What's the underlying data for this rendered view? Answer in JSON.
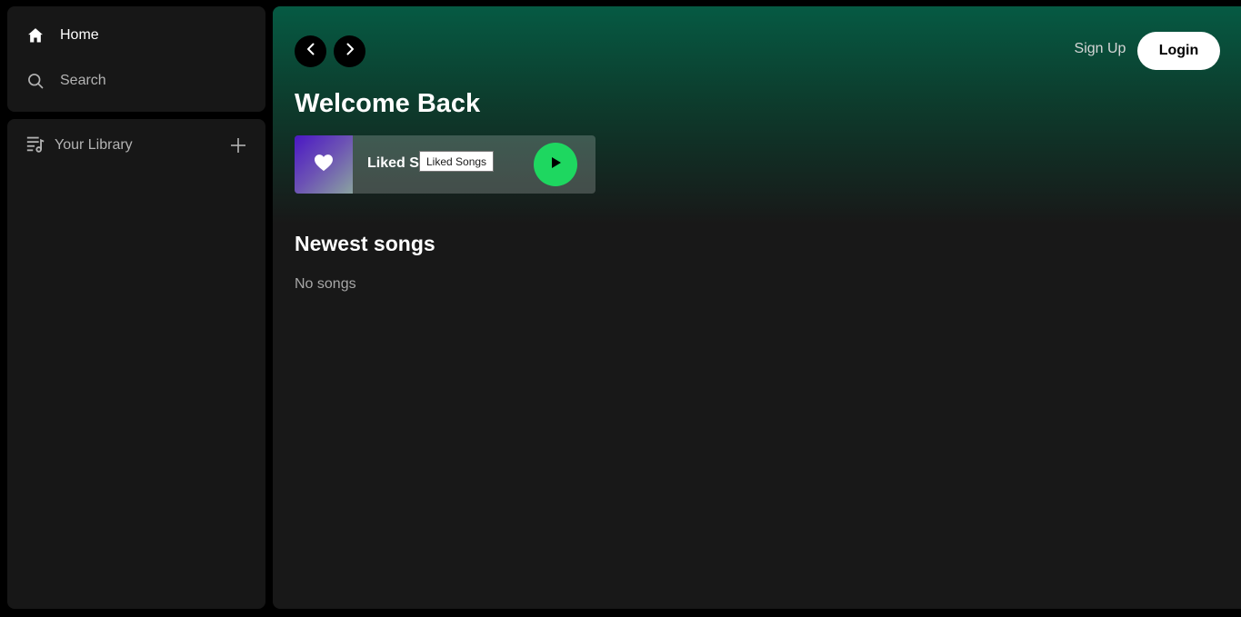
{
  "sidebar": {
    "nav": [
      {
        "label": "Home",
        "icon": "home-icon",
        "active": true
      },
      {
        "label": "Search",
        "icon": "search-icon",
        "active": false
      }
    ],
    "library": {
      "label": "Your Library",
      "icon": "library-icon",
      "add_icon": "plus-icon"
    }
  },
  "header": {
    "back_icon": "chevron-left-icon",
    "forward_icon": "chevron-right-icon",
    "signup_label": "Sign Up",
    "login_label": "Login"
  },
  "main": {
    "welcome_title": "Welcome Back",
    "liked_card": {
      "title": "Liked Songs",
      "icon": "heart-icon",
      "play_icon": "play-icon"
    },
    "tooltip": "Liked Songs",
    "newest_title": "Newest songs",
    "empty_text": "No songs"
  },
  "colors": {
    "accent": "#1ed760",
    "gradient_top": "#065a43",
    "panel": "#171717",
    "main_bg": "#181818"
  }
}
